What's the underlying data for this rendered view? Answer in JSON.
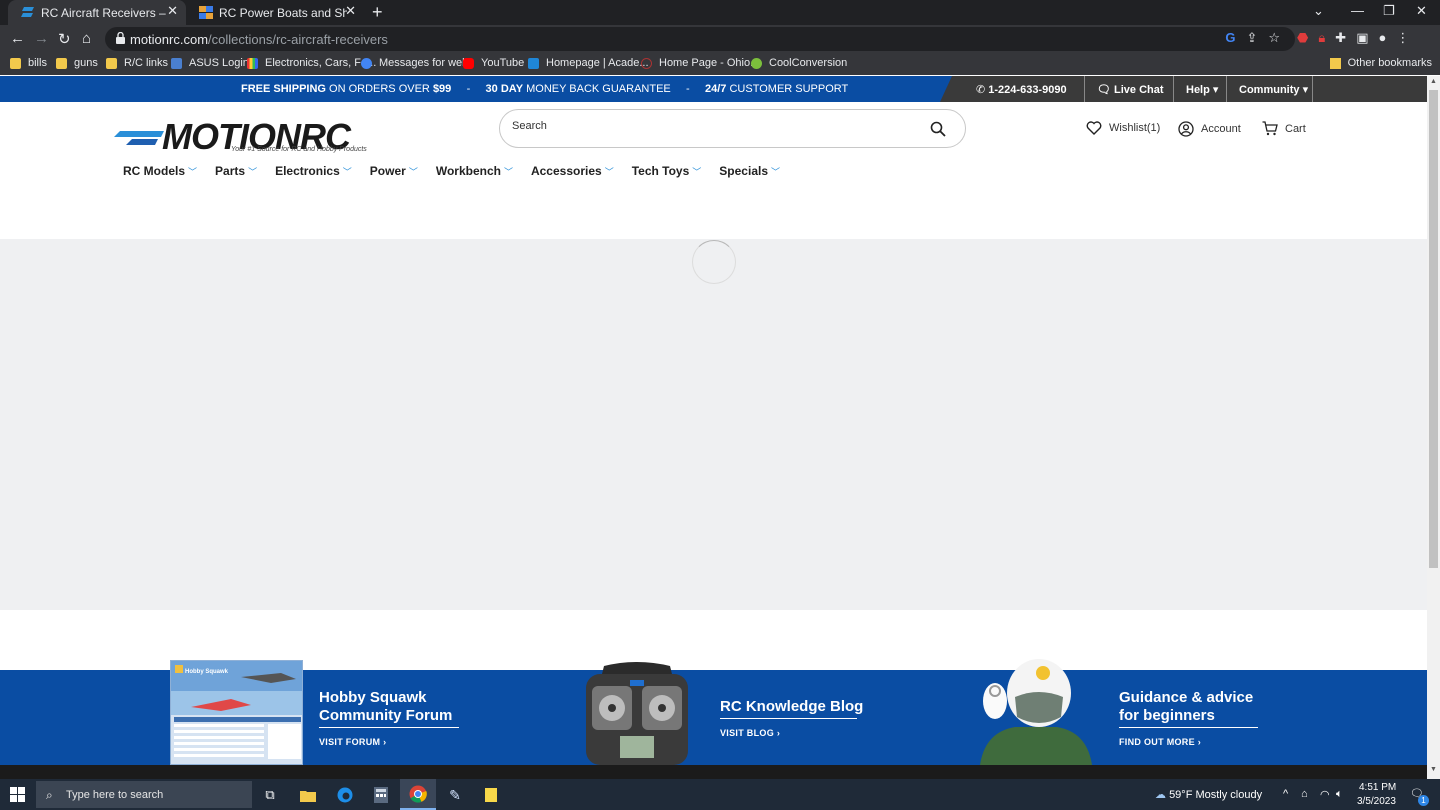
{
  "browser": {
    "tabs": [
      {
        "title": "RC Aircraft Receivers – Motion RC",
        "active": true
      },
      {
        "title": "RC Power Boats and Ships - Hobby",
        "active": false
      }
    ],
    "new_tab": "+",
    "url_host": "motionrc.com",
    "url_path": "/collections/rc-aircraft-receivers",
    "bookmarks": [
      "bills",
      "guns",
      "R/C links",
      "ASUS Login",
      "Electronics, Cars, Fa...",
      "Messages for web",
      "YouTube",
      "Homepage | Acade...",
      "Home Page - Ohio...",
      "CoolConversion"
    ],
    "other_bookmarks": "Other bookmarks"
  },
  "site": {
    "announce": {
      "shipping_bold": "FREE SHIPPING",
      "shipping_rest": " ON ORDERS OVER ",
      "shipping_amount": "$99",
      "sep": "-",
      "guarantee_bold": "30 DAY",
      "guarantee_rest": " MONEY BACK GUARANTEE",
      "support_bold": "24/7",
      "support_rest": " CUSTOMER SUPPORT"
    },
    "topbar": {
      "phone": "1-224-633-9090",
      "live_chat": "Live Chat",
      "help": "Help",
      "community": "Community"
    },
    "logo_text": "MOTIONRC",
    "tagline": "Your #1 Source for RC and Hobby Products",
    "search_placeholder": "Search",
    "wishlist": "Wishlist(1)",
    "account": "Account",
    "cart": "Cart",
    "nav": [
      "RC Models",
      "Parts",
      "Electronics",
      "Power",
      "Workbench",
      "Accessories",
      "Tech Toys",
      "Specials"
    ],
    "promos": [
      {
        "title_1": "Hobby Squawk",
        "title_2": "Community Forum",
        "link": "VISIT FORUM"
      },
      {
        "title_1": "RC Knowledge Blog",
        "link": "VISIT BLOG"
      },
      {
        "title_1": "Guidance & advice",
        "title_2": "for beginners",
        "link": "FIND OUT MORE"
      }
    ],
    "forum_thumb_logo": "Hobby Squawk"
  },
  "taskbar": {
    "search_placeholder": "Type here to search",
    "weather": "59°F  Mostly cloudy",
    "time": "4:51 PM",
    "date": "3/5/2023",
    "notification_count": "1"
  },
  "colors": {
    "brand_blue": "#0a4da3",
    "accent_blue": "#2a8fd8"
  }
}
